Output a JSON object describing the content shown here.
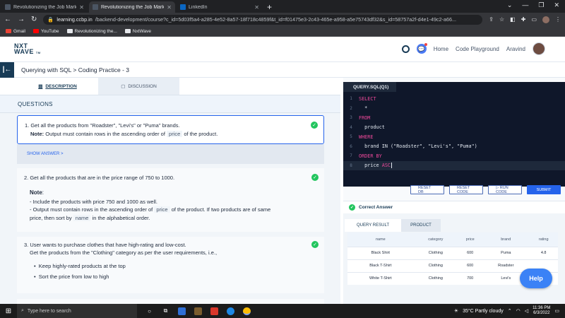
{
  "browser": {
    "tabs": [
      {
        "title": "Revolutionizing the Job Market |",
        "icon": "ccbp-icon",
        "active": false
      },
      {
        "title": "Revolutionizing the Job Market |",
        "icon": "ccbp-icon",
        "active": true
      },
      {
        "title": "LinkedIn",
        "icon": "linkedin-icon",
        "active": false
      }
    ],
    "new_tab": "+",
    "url_host": "learning.ccbp.in",
    "url_path": "/backend-development/course?c_id=5d03f5a4-a285-4e52-8a57-18f718c4859f&t_id=f01475e3-2c43-465e-a958-a5e75743df32&s_id=58757a2f-d4e1-49c2-a66...",
    "bookmarks": [
      "Gmail",
      "YouTube",
      "Revolutionizing the...",
      "NxtWave"
    ]
  },
  "site": {
    "logo_line1": "NXT",
    "logo_line2": "WAVE",
    "logo_tm": "TM",
    "nav": [
      "Home",
      "Code Playground",
      "Aravind"
    ]
  },
  "breadcrumb": "Querying with SQL > Coding Practice - 3",
  "left": {
    "tabs": [
      "DESCRIPTION",
      "DISCUSSION"
    ],
    "section_title": "QUESTIONS",
    "q1": {
      "text": "1.  Get all the products from \"Roadster\", \"Levi's\" or \"Puma\" brands.",
      "note_label": "Note:",
      "note_pre": " Output must contain rows in the ascending order of ",
      "note_code": "price",
      "note_post": " of the product."
    },
    "show_answer": "SHOW ANSWER >",
    "q2": {
      "text": "2.  Get all the products that are in the price range of 750 to 1000.",
      "note_label": "Note",
      "line1": "-  Include the products with price 750 and 1000 as well.",
      "line2_pre": "-  Output must contain rows in the ascending order of ",
      "line2_code": "price",
      "line2_post": " of the product. If two products are of same",
      "line3_pre": "price, then sort by ",
      "line3_code": "name",
      "line3_post": " in the alphabetical order."
    },
    "q3": {
      "text": "3.  User wants to purchase clothes that have high-rating and low-cost.",
      "text2": "Get the products from the \"Clothing\" category as per the user requirements, i.e.,",
      "bullets": [
        "Keep highly-rated products at the top",
        "Sort the price from low to high"
      ]
    }
  },
  "editor": {
    "tab": "QUERY.SQL(Q1)",
    "lines": [
      {
        "n": "1",
        "kw": "SELECT",
        "rest": ""
      },
      {
        "n": "2",
        "kw": "",
        "rest": "  *"
      },
      {
        "n": "3",
        "kw": "FROM",
        "rest": ""
      },
      {
        "n": "4",
        "kw": "",
        "rest": "  product"
      },
      {
        "n": "5",
        "kw": "WHERE",
        "rest": ""
      },
      {
        "n": "6",
        "kw": "",
        "rest": "  brand IN (\"Roadster\", \"Levi's\", \"Puma\")"
      },
      {
        "n": "7",
        "kw": "ORDER BY",
        "rest": ""
      },
      {
        "n": "8",
        "kw": "",
        "rest": "  price ",
        "trail_kw": "ASC"
      }
    ],
    "buttons": [
      "RESET DB",
      "RESET CODE",
      "▷ RUN CODE",
      "SUBMIT"
    ]
  },
  "result": {
    "status": "Correct Answer",
    "tabs": [
      "QUERY RESULT",
      "PRODUCT"
    ],
    "columns": [
      "name",
      "category",
      "price",
      "brand",
      "rating"
    ],
    "rows": [
      [
        "Black Shirt",
        "Clothing",
        "600",
        "Puma",
        "4.8"
      ],
      [
        "Black T-Shirt",
        "Clothing",
        "600",
        "Roadster",
        ""
      ],
      [
        "White T-Shirt",
        "Clothing",
        "700",
        "Levi's",
        ""
      ]
    ],
    "help": "Help"
  },
  "taskbar": {
    "search_placeholder": "Type here to search",
    "weather": "35°C  Partly cloudy",
    "time": "11:36 PM",
    "date": "6/3/2022"
  }
}
